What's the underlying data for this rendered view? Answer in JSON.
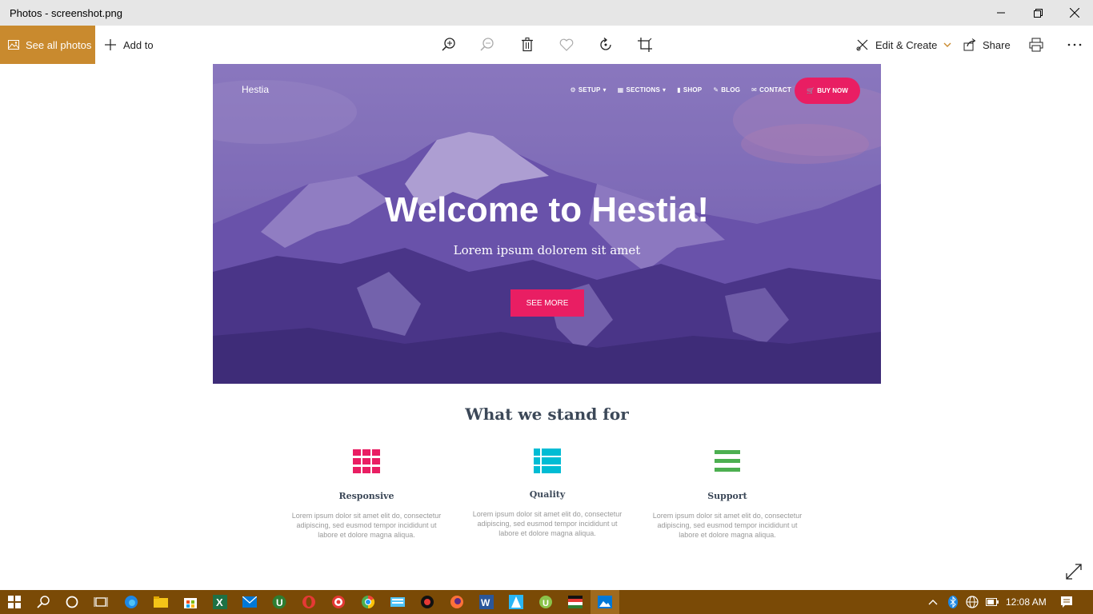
{
  "window": {
    "title": "Photos - screenshot.png"
  },
  "toolbar": {
    "see_all_photos": "See all photos",
    "add_to": "Add to",
    "edit_create": "Edit & Create",
    "share": "Share"
  },
  "site": {
    "brand": "Hestia",
    "nav": [
      "SETUP",
      "SECTIONS",
      "SHOP",
      "BLOG",
      "CONTACT"
    ],
    "buy_now": "BUY NOW",
    "hero_title": "Welcome to Hestia!",
    "hero_subtitle": "Lorem ipsum dolorem sit amet",
    "see_more": "SEE MORE",
    "section_title": "What we stand for",
    "features": [
      {
        "name": "Responsive",
        "desc": "Lorem ipsum dolor sit amet elit do, consectetur adipiscing, sed eusmod tempor incididunt ut labore et dolore magna aliqua.",
        "color": "#e91e63",
        "icon": "grid-icon"
      },
      {
        "name": "Quality",
        "desc": "Lorem ipsum dolor sit amet elit do, consectetur adipiscing, sed eusmod tempor incididunt ut labore et dolore magna aliqua.",
        "color": "#00bcd4",
        "icon": "list-icon"
      },
      {
        "name": "Support",
        "desc": "Lorem ipsum dolor sit amet elit do, consectetur adipiscing, sed eusmod tempor incididunt ut labore et dolore magna aliqua.",
        "color": "#4caf50",
        "icon": "bars-icon"
      }
    ]
  },
  "taskbar": {
    "clock": "12:08 AM",
    "color": "#7a4a06"
  }
}
